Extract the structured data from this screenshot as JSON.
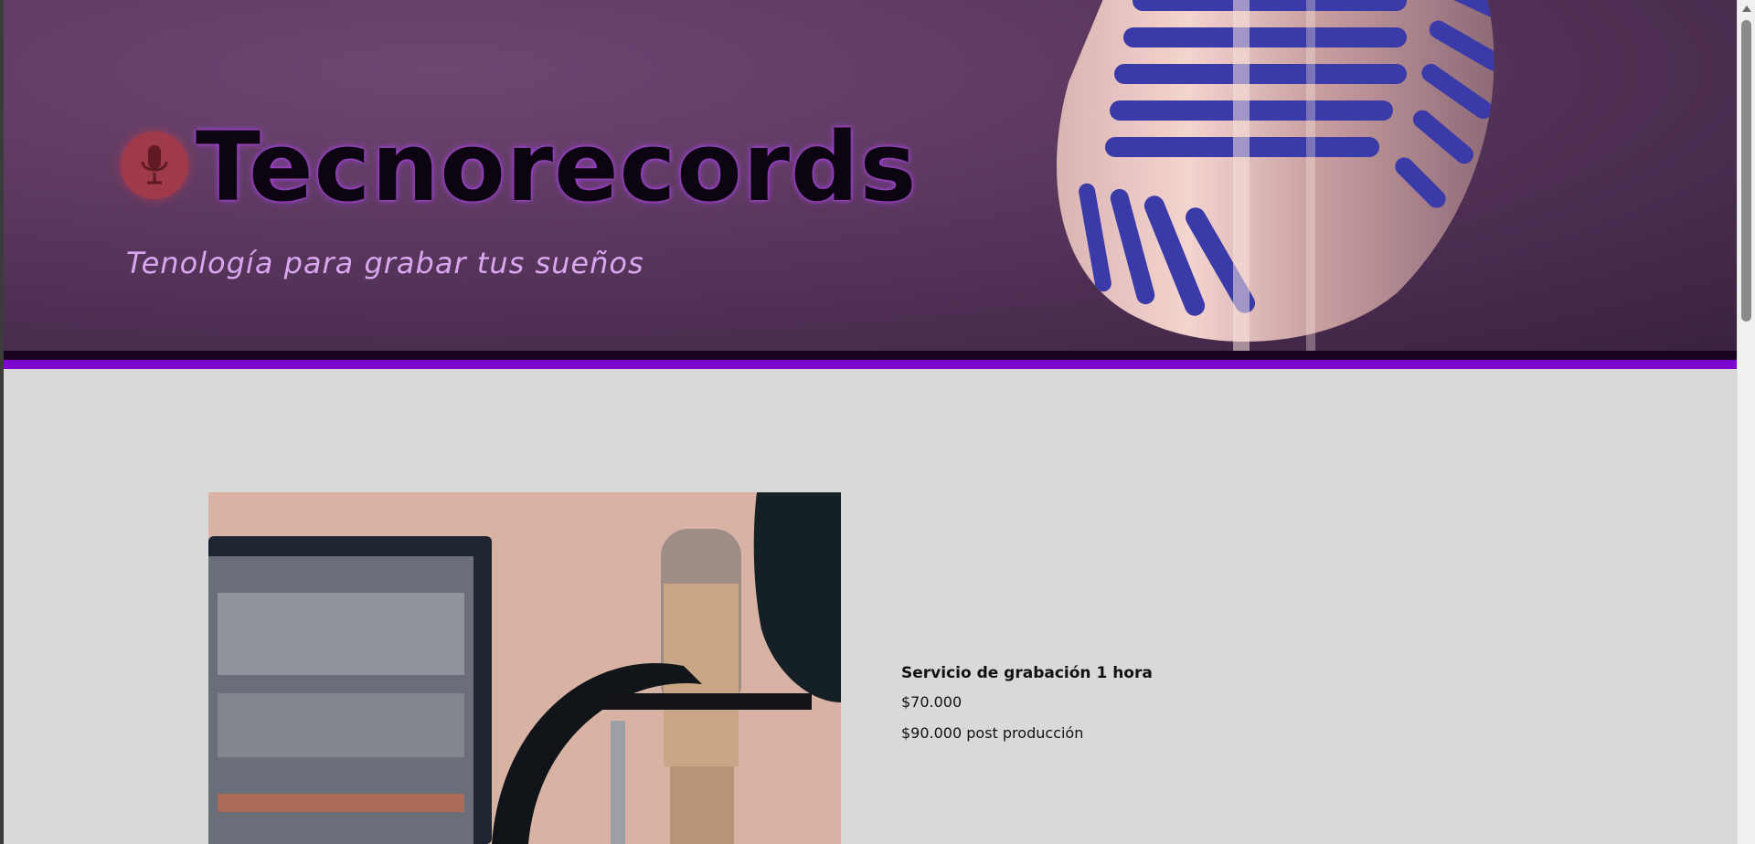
{
  "header": {
    "title": "Tecnorecords",
    "subtitle": "Tenología para grabar tus sueños",
    "logo_icon": "microphone-icon",
    "accent_color": "#7d07cf",
    "title_glow_color": "#a93cf0",
    "subtitle_color": "#d9a6ef"
  },
  "product": {
    "image": "studio-microphone-photo",
    "title": "Servicio de grabación 1 hora",
    "price": "$70.000",
    "price_post": "$90.000 post producción"
  },
  "scrollbar": {
    "up_icon": "scroll-up-arrow-icon"
  }
}
